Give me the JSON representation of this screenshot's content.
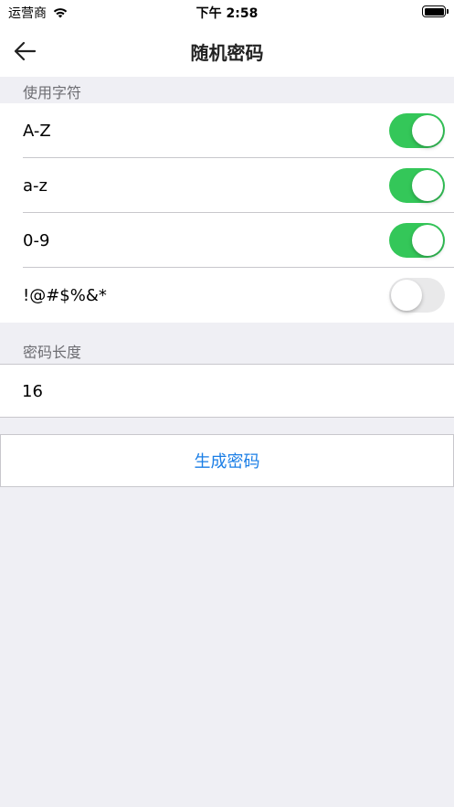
{
  "status_bar": {
    "carrier": "运营商",
    "time": "下午 2:58"
  },
  "nav": {
    "title": "随机密码",
    "back_icon": "arrow-left-icon"
  },
  "charset_section": {
    "header": "使用字符",
    "items": [
      {
        "label": "A-Z",
        "enabled": true
      },
      {
        "label": "a-z",
        "enabled": true
      },
      {
        "label": "0-9",
        "enabled": true
      },
      {
        "label": "!@#$%&*",
        "enabled": false
      }
    ]
  },
  "length_section": {
    "header": "密码长度",
    "value": "16"
  },
  "generate_button": {
    "label": "生成密码"
  },
  "colors": {
    "toggle_on": "#34c759",
    "toggle_off": "#e9e9ea",
    "accent": "#1a7ee6",
    "background": "#efeff4"
  }
}
